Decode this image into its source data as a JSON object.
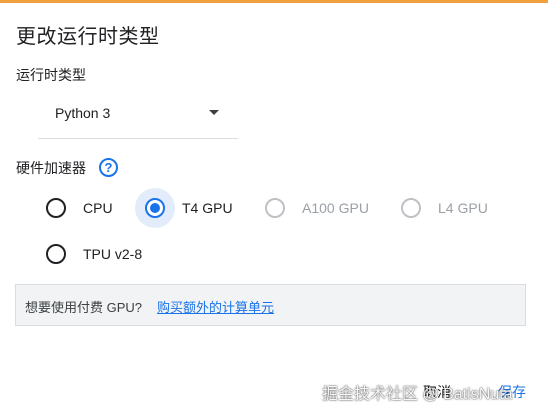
{
  "dialog": {
    "title": "更改运行时类型"
  },
  "runtime": {
    "label": "运行时类型",
    "selected": "Python 3"
  },
  "accelerator": {
    "label": "硬件加速器",
    "help_glyph": "?",
    "help_icon": "help-circle-icon",
    "options": [
      {
        "label": "CPU",
        "checked": false,
        "disabled": false
      },
      {
        "label": "T4 GPU",
        "checked": true,
        "disabled": false
      },
      {
        "label": "A100 GPU",
        "checked": false,
        "disabled": true
      },
      {
        "label": "L4 GPU",
        "checked": false,
        "disabled": true
      },
      {
        "label": "TPU v2-8",
        "checked": false,
        "disabled": false
      }
    ]
  },
  "notice": {
    "text": "想要使用付费 GPU?",
    "link": "购买额外的计算单元"
  },
  "footer": {
    "cancel": "取消",
    "save": "保存"
  },
  "watermark": {
    "text": "掘金技术社区 @ BatisNuta"
  },
  "colors": {
    "accent": "#1a73e8",
    "top_strip": "#f2a03d",
    "notice_bg": "#f1f3f4"
  }
}
